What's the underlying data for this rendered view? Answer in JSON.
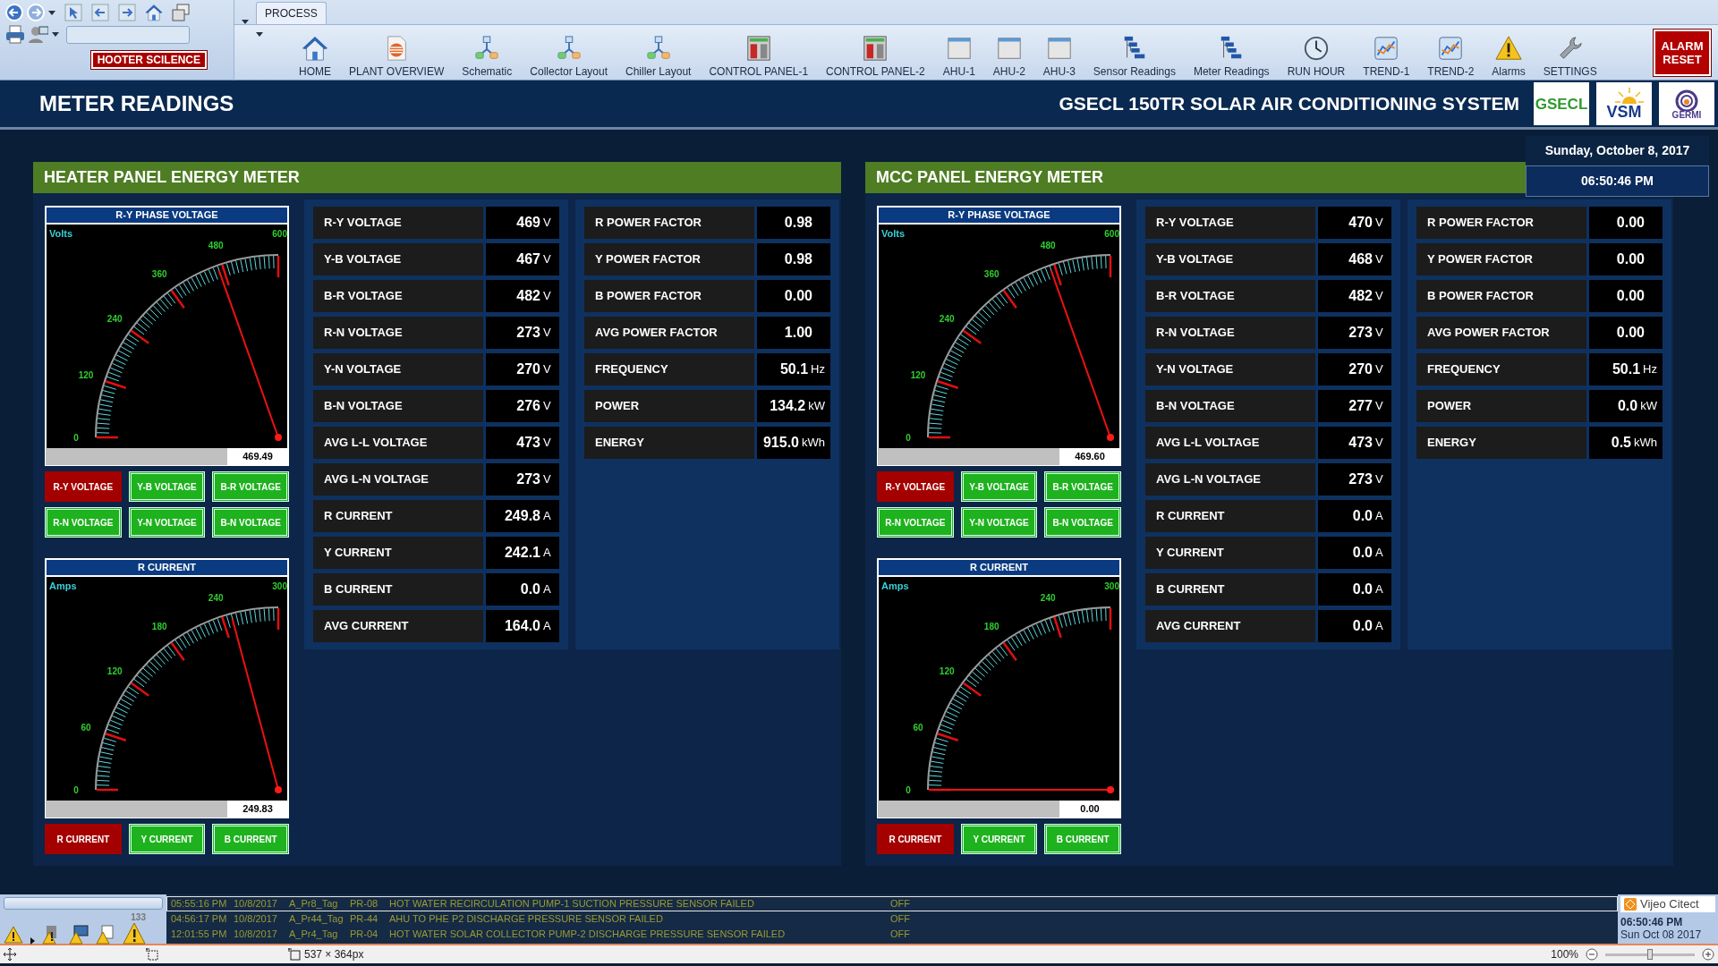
{
  "toolbar": {
    "hooter_button": "HOOTER SCILENCE",
    "tab": "PROCESS",
    "items": [
      {
        "label": "HOME"
      },
      {
        "label": "PLANT OVERVIEW"
      },
      {
        "label": "Schematic"
      },
      {
        "label": "Collector Layout"
      },
      {
        "label": "Chiller Layout"
      },
      {
        "label": "CONTROL PANEL-1"
      },
      {
        "label": "CONTROL PANEL-2"
      },
      {
        "label": "AHU-1"
      },
      {
        "label": "AHU-2"
      },
      {
        "label": "AHU-3"
      },
      {
        "label": "Sensor Readings"
      },
      {
        "label": "Meter Readings"
      },
      {
        "label": "RUN HOUR"
      },
      {
        "label": "TREND-1"
      },
      {
        "label": "TREND-2"
      },
      {
        "label": "Alarms"
      },
      {
        "label": "SETTINGS"
      }
    ],
    "alarm_reset": "ALARM RESET"
  },
  "header": {
    "title": "METER READINGS",
    "system_title": "GSECL 150TR SOLAR AIR CONDITIONING SYSTEM",
    "logos": [
      {
        "text": "GSECL",
        "kind": "letters"
      },
      {
        "text": "VSM",
        "kind": "sun"
      },
      {
        "text": "GERMI",
        "kind": "rings"
      }
    ]
  },
  "datetime": {
    "date": "Sunday, October 8, 2017",
    "time": "06:50:46 PM"
  },
  "panels": [
    {
      "title": "HEATER PANEL ENERGY METER",
      "gauges": [
        {
          "title": "R-Y PHASE VOLTAGE",
          "unit": "Volts",
          "scale": [
            "0",
            "120",
            "240",
            "360",
            "480",
            "600"
          ],
          "reading": "469.49",
          "buttons": [
            {
              "label": "R-Y VOLTAGE",
              "selected": true
            },
            {
              "label": "Y-B VOLTAGE",
              "selected": false
            },
            {
              "label": "B-R VOLTAGE",
              "selected": false
            },
            {
              "label": "R-N VOLTAGE",
              "selected": false
            },
            {
              "label": "Y-N VOLTAGE",
              "selected": false
            },
            {
              "label": "B-N VOLTAGE",
              "selected": false
            }
          ]
        },
        {
          "title": "R CURRENT",
          "unit": "Amps",
          "scale": [
            "0",
            "60",
            "120",
            "180",
            "240",
            "300"
          ],
          "reading": "249.83",
          "buttons": [
            {
              "label": "R CURRENT",
              "selected": true
            },
            {
              "label": "Y CURRENT",
              "selected": false
            },
            {
              "label": "B CURRENT",
              "selected": false
            }
          ]
        }
      ],
      "tables": [
        [
          {
            "label": "R-Y VOLTAGE",
            "value": "469",
            "unit": "V"
          },
          {
            "label": "Y-B VOLTAGE",
            "value": "467",
            "unit": "V"
          },
          {
            "label": "B-R VOLTAGE",
            "value": "482",
            "unit": "V"
          },
          {
            "label": "R-N VOLTAGE",
            "value": "273",
            "unit": "V"
          },
          {
            "label": "Y-N VOLTAGE",
            "value": "270",
            "unit": "V"
          },
          {
            "label": "B-N VOLTAGE",
            "value": "276",
            "unit": "V"
          },
          {
            "label": "AVG L-L VOLTAGE",
            "value": "473",
            "unit": "V"
          },
          {
            "label": "AVG L-N VOLTAGE",
            "value": "273",
            "unit": "V"
          },
          {
            "label": "R CURRENT",
            "value": "249.8",
            "unit": "A"
          },
          {
            "label": "Y CURRENT",
            "value": "242.1",
            "unit": "A"
          },
          {
            "label": "B CURRENT",
            "value": "0.0",
            "unit": "A"
          },
          {
            "label": "AVG CURRENT",
            "value": "164.0",
            "unit": "A"
          }
        ],
        [
          {
            "label": "R POWER FACTOR",
            "value": "0.98"
          },
          {
            "label": "Y POWER FACTOR",
            "value": "0.98"
          },
          {
            "label": "B POWER FACTOR",
            "value": "0.00"
          },
          {
            "label": "AVG POWER FACTOR",
            "value": "1.00"
          },
          {
            "label": "FREQUENCY",
            "value": "50.1",
            "unit": "Hz"
          },
          {
            "label": "POWER",
            "value": "134.2",
            "unit": "kW"
          },
          {
            "label": "ENERGY",
            "value": "915.0",
            "unit": "kWh"
          }
        ]
      ]
    },
    {
      "title": "MCC PANEL ENERGY METER",
      "gauges": [
        {
          "title": "R-Y PHASE VOLTAGE",
          "unit": "Volts",
          "scale": [
            "0",
            "120",
            "240",
            "360",
            "480",
            "600"
          ],
          "reading": "469.60",
          "buttons": [
            {
              "label": "R-Y VOLTAGE",
              "selected": true
            },
            {
              "label": "Y-B VOLTAGE",
              "selected": false
            },
            {
              "label": "B-R VOLTAGE",
              "selected": false
            },
            {
              "label": "R-N VOLTAGE",
              "selected": false
            },
            {
              "label": "Y-N VOLTAGE",
              "selected": false
            },
            {
              "label": "B-N VOLTAGE",
              "selected": false
            }
          ]
        },
        {
          "title": "R CURRENT",
          "unit": "Amps",
          "scale": [
            "0",
            "60",
            "120",
            "180",
            "240",
            "300"
          ],
          "reading": "0.00",
          "buttons": [
            {
              "label": "R CURRENT",
              "selected": true
            },
            {
              "label": "Y CURRENT",
              "selected": false
            },
            {
              "label": "B CURRENT",
              "selected": false
            }
          ]
        }
      ],
      "tables": [
        [
          {
            "label": "R-Y VOLTAGE",
            "value": "470",
            "unit": "V"
          },
          {
            "label": "Y-B VOLTAGE",
            "value": "468",
            "unit": "V"
          },
          {
            "label": "B-R VOLTAGE",
            "value": "482",
            "unit": "V"
          },
          {
            "label": "R-N VOLTAGE",
            "value": "273",
            "unit": "V"
          },
          {
            "label": "Y-N VOLTAGE",
            "value": "270",
            "unit": "V"
          },
          {
            "label": "B-N VOLTAGE",
            "value": "277",
            "unit": "V"
          },
          {
            "label": "AVG L-L VOLTAGE",
            "value": "473",
            "unit": "V"
          },
          {
            "label": "AVG L-N VOLTAGE",
            "value": "273",
            "unit": "V"
          },
          {
            "label": "R CURRENT",
            "value": "0.0",
            "unit": "A"
          },
          {
            "label": "Y CURRENT",
            "value": "0.0",
            "unit": "A"
          },
          {
            "label": "B CURRENT",
            "value": "0.0",
            "unit": "A"
          },
          {
            "label": "AVG CURRENT",
            "value": "0.0",
            "unit": "A"
          }
        ],
        [
          {
            "label": "R POWER FACTOR",
            "value": "0.00"
          },
          {
            "label": "Y POWER FACTOR",
            "value": "0.00"
          },
          {
            "label": "B POWER FACTOR",
            "value": "0.00"
          },
          {
            "label": "AVG POWER FACTOR",
            "value": "0.00"
          },
          {
            "label": "FREQUENCY",
            "value": "50.1",
            "unit": "Hz"
          },
          {
            "label": "POWER",
            "value": "0.0",
            "unit": "kW"
          },
          {
            "label": "ENERGY",
            "value": "0.5",
            "unit": "kWh"
          }
        ]
      ]
    }
  ],
  "alarm_count": "133",
  "alarms": [
    {
      "time": "05:55:16 PM",
      "date": "10/8/2017",
      "tag": "A_Pr8_Tag",
      "code": "PR-08",
      "message": "HOT WATER RECIRCULATION PUMP-1 SUCTION PRESSURE SENSOR FAILED",
      "state": "OFF",
      "selected": true
    },
    {
      "time": "04:56:17 PM",
      "date": "10/8/2017",
      "tag": "A_Pr44_Tag",
      "code": "PR-44",
      "message": "AHU TO PHE P2 DISCHARGE PRESSURE SENSOR FAILED",
      "state": "OFF",
      "selected": false
    },
    {
      "time": "12:01:55 PM",
      "date": "10/8/2017",
      "tag": "A_Pr4_Tag",
      "code": "PR-04",
      "message": "HOT WATER SOLAR COLLECTOR PUMP-2 DISCHARGE PRESSURE SENSOR FAILED",
      "state": "OFF",
      "selected": false
    }
  ],
  "brand": {
    "name": "Vijeo Citect",
    "time": "06:50:46 PM",
    "date": "Sun Oct 08 2017"
  },
  "status_bar": {
    "size": "537 × 364px",
    "zoom": "100%",
    "zoom_slider": {
      "level": 0.5
    }
  }
}
